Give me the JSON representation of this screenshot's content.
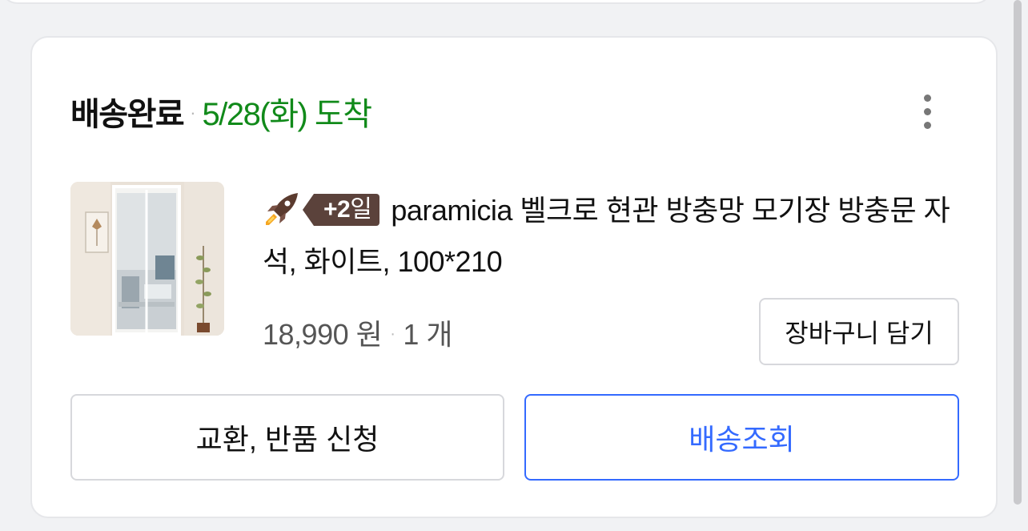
{
  "order": {
    "status": "배송완료",
    "separator": "·",
    "arrival": "5/28(화) 도착",
    "more_icon": "kebab-vertical-icon",
    "product": {
      "icon": "rocket-delivery-icon",
      "badge_number": "+2",
      "badge_unit": "일",
      "title": "paramicia 벨크로 현관 방충망 모기장 방충문 자석, 화이트, 100*210",
      "price": "18,990 원",
      "quantity": "1 개"
    },
    "buttons": {
      "add_to_cart": "장바구니 담기",
      "exchange_return": "교환, 반품 신청",
      "track_delivery": "배송조회"
    }
  },
  "colors": {
    "arrival_green": "#118a1a",
    "accent_blue": "#346aff",
    "badge_brown": "#5b423b"
  }
}
